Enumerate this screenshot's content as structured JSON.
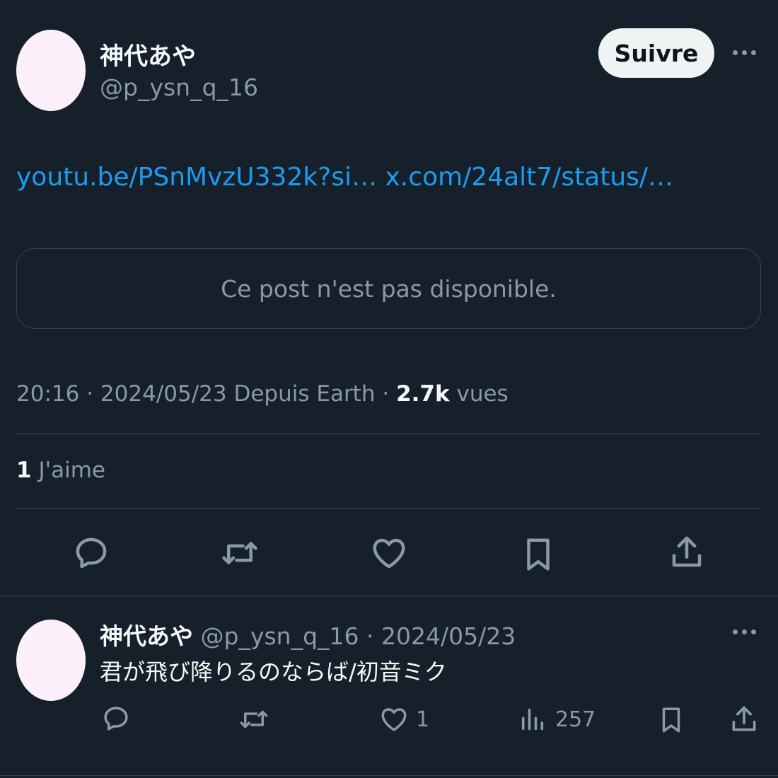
{
  "post": {
    "author_name": "神代あや",
    "handle": "@p_ysn_q_16",
    "follow_label": "Suivre",
    "links": [
      "youtu.be/PSnMvzU332k?si…",
      "x.com/24alt7/status/…"
    ],
    "quoted_unavailable": "Ce post n'est pas disponible.",
    "time": "20:16",
    "sep": "·",
    "date": "2024/05/23",
    "source": "Depuis Earth",
    "views_count": "2.7k",
    "views_label": "vues",
    "likes_count": "1",
    "likes_label": "J'aime"
  },
  "reply": {
    "author_name": "神代あや",
    "handle": "@p_ysn_q_16",
    "date_prefix": "· 2024/05/23",
    "text": "君が飛び降りるのならば/初音ミク",
    "like_count": "1",
    "views_count": "257"
  },
  "icons": {
    "reply": "speech-bubble-icon",
    "repost": "repost-arrows-icon",
    "like": "heart-icon",
    "bookmark": "bookmark-icon",
    "share": "share-upload-icon",
    "views": "bar-chart-icon",
    "more": "more-dots-icon"
  },
  "colors": {
    "background": "#15202b",
    "link": "#1d9bf0",
    "muted": "#8b98a5",
    "divider": "#38444d",
    "avatar": "#fdf0fb"
  }
}
